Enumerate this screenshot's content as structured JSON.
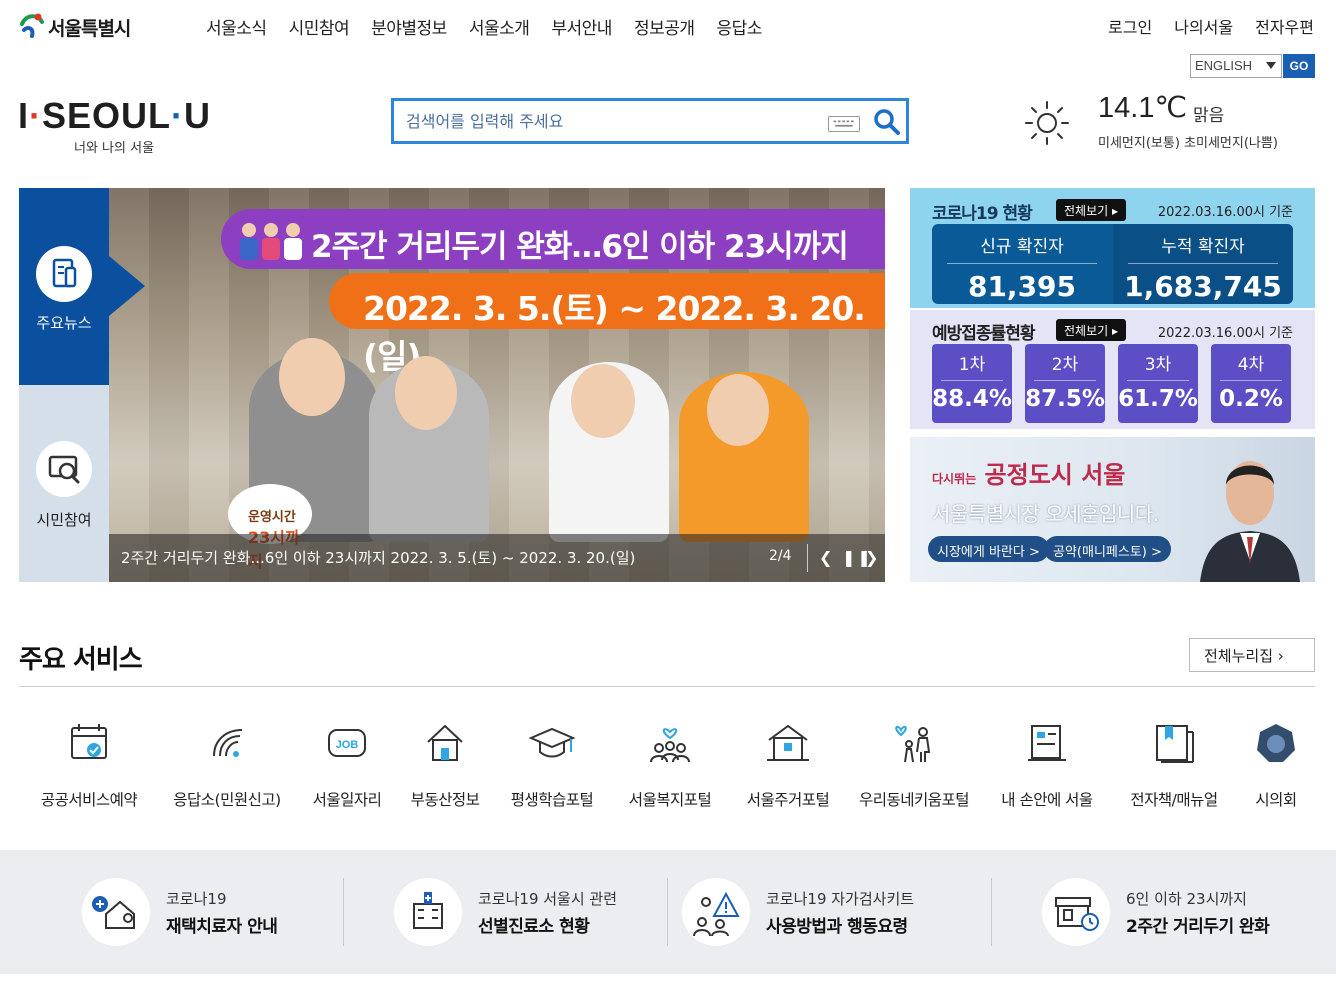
{
  "header": {
    "site_name": "서울특별시",
    "gnb": [
      "서울소식",
      "시민참여",
      "분야별정보",
      "서울소개",
      "부서안내",
      "정보공개",
      "응답소"
    ],
    "util": [
      "로그인",
      "나의서울",
      "전자우편"
    ],
    "language": "ENGLISH",
    "go_label": "GO"
  },
  "brand": {
    "slogan_i": "I",
    "slogan_seoul": "SEOUL",
    "slogan_u": "U",
    "sub": "너와 나의 서울"
  },
  "search": {
    "placeholder": "검색어를 입력해 주세요"
  },
  "weather": {
    "temp": "14.1℃",
    "condition": "맑음",
    "dust": "미세먼지(보통) 초미세먼지(나쁨)"
  },
  "hero": {
    "tabs": [
      "주요뉴스",
      "시민참여"
    ],
    "headline": "2주간 거리두기 완화…6인 이하 23시까지",
    "dates": "2022. 3. 5.(토) ~ 2022. 3. 20.(일)",
    "badge_top": "운영시간",
    "badge_bottom": "23시까지",
    "caption": "2주간 거리두기 완화...6인 이하 23시까지 2022. 3. 5.(토) ~ 2022. 3. 20.(일)",
    "counter": "2/4"
  },
  "covid": {
    "title": "코로나19 현황",
    "view_all": "전체보기",
    "date": "2022.03.16.00시 기준",
    "new_label": "신규 확진자",
    "new_value": "81,395",
    "total_label": "누적 확진자",
    "total_value": "1,683,745"
  },
  "vaccine": {
    "title": "예방접종률현황",
    "view_all": "전체보기",
    "date": "2022.03.16.00시 기준",
    "doses": [
      {
        "label": "1차",
        "value": "88.4%"
      },
      {
        "label": "2차",
        "value": "87.5%"
      },
      {
        "label": "3차",
        "value": "61.7%"
      },
      {
        "label": "4차",
        "value": "0.2%"
      }
    ]
  },
  "mayor": {
    "slogan_small": "다시뛰는",
    "slogan": "공정도시 서울",
    "who": "서울특별시장 오세훈입니다.",
    "btn1": "시장에게 바란다 >",
    "btn2": "공약(매니페스토) >"
  },
  "services": {
    "title": "주요 서비스",
    "all": "전체누리집",
    "items": [
      "공공서비스예약",
      "응답소(민원신고)",
      "서울일자리",
      "부동산정보",
      "평생학습포털",
      "서울복지포털",
      "서울주거포털",
      "우리동네키움포털",
      "내 손안에 서울",
      "전자책/매뉴얼",
      "시의회"
    ],
    "icons": [
      "calendar-check-icon",
      "signal-icon",
      "job-icon",
      "house-icon",
      "graduation-cap-icon",
      "community-icon",
      "apartment-icon",
      "family-icon",
      "mobile-board-icon",
      "book-icon",
      "council-emblem-icon"
    ]
  },
  "quick": [
    {
      "top": "코로나19",
      "bottom": "재택치료자 안내"
    },
    {
      "top": "코로나19 서울시 관련",
      "bottom": "선별진료소 현황"
    },
    {
      "top": "코로나19 자가검사키트",
      "bottom": "사용방법과 행동요령"
    },
    {
      "top": "6인 이하 23시까지",
      "bottom": "2주간 거리두기 완화"
    }
  ]
}
